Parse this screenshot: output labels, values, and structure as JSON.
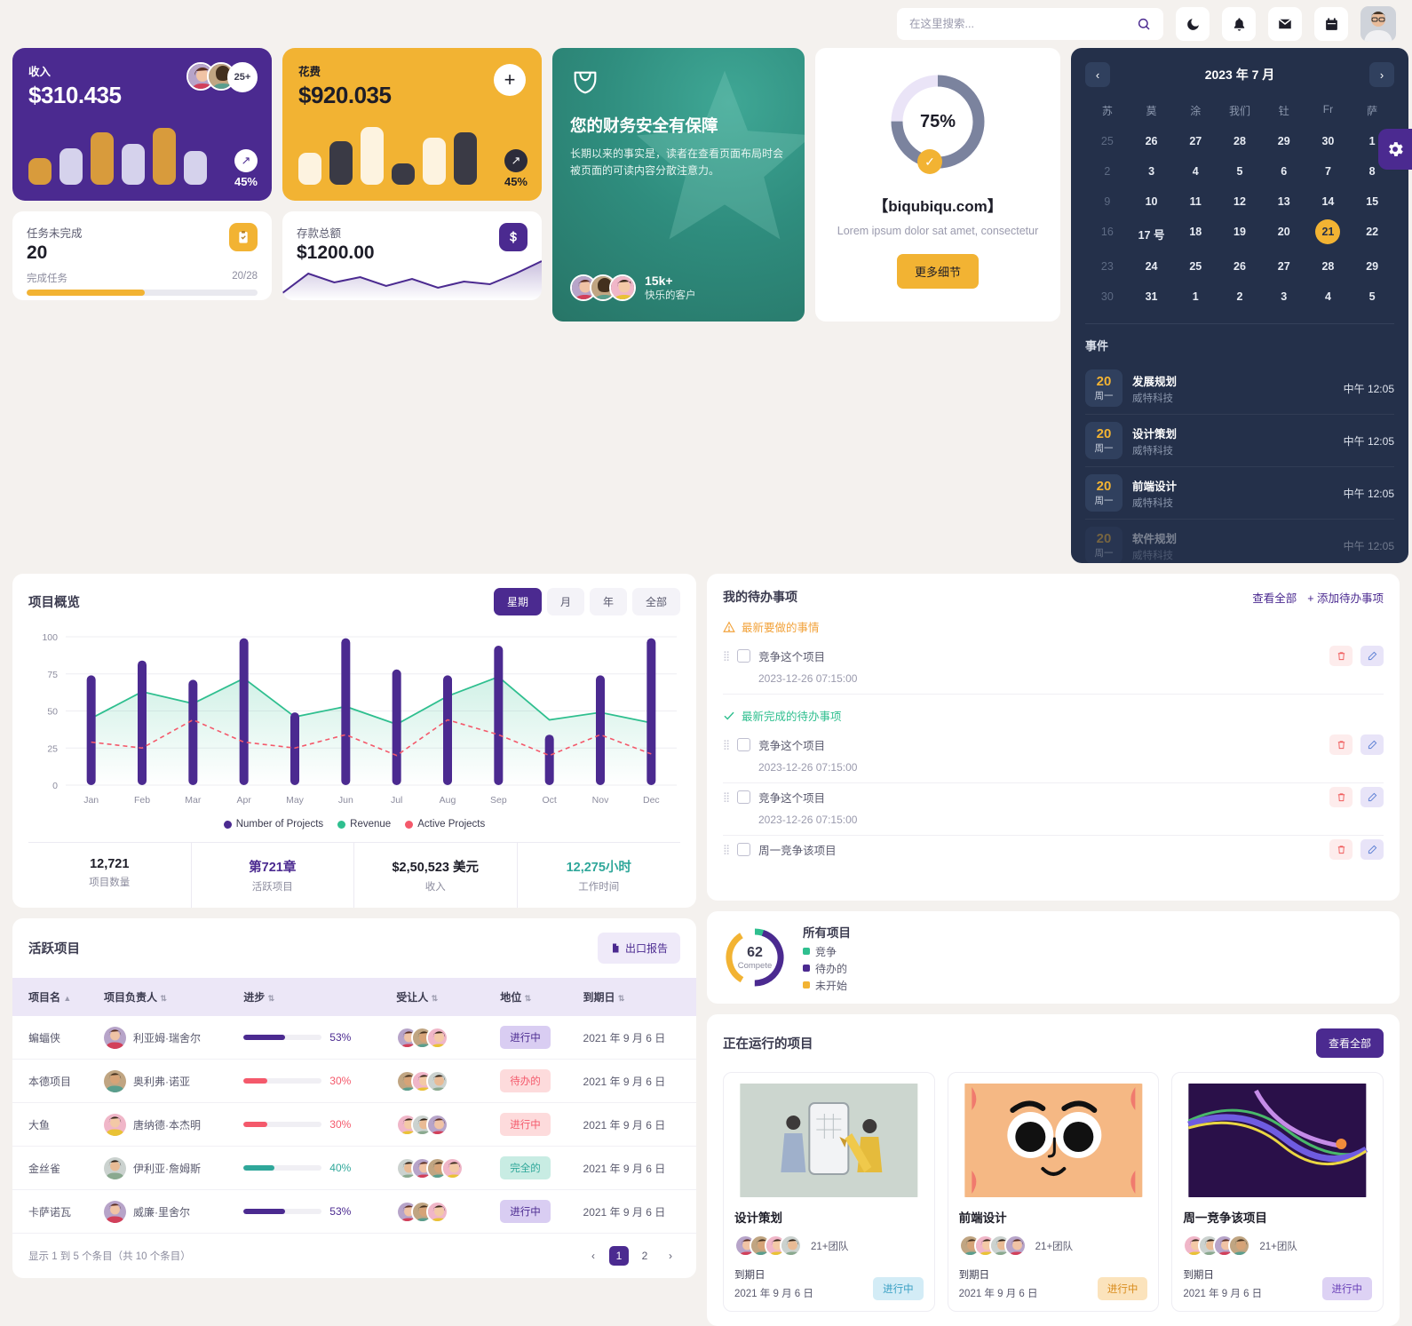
{
  "header": {
    "search_placeholder": "在这里搜索...",
    "search_value": "",
    "icons": [
      "moon-icon",
      "bell-icon",
      "envelope-icon",
      "calendar-icon"
    ]
  },
  "settings_tab": {
    "icon": "gear-icon"
  },
  "revenue_card": {
    "label": "收入",
    "value": "$310.435",
    "avatar_more": "25+",
    "trend_pct": "45%",
    "bars": [
      40,
      55,
      80,
      62,
      86,
      52
    ],
    "bar_colors": [
      "#d89b3c",
      "#d5d2ec",
      "#d89b3c",
      "#d5d2ec",
      "#d89b3c",
      "#d5d2ec"
    ]
  },
  "expense_card": {
    "label": "花费",
    "value": "$920.035",
    "add_label": "+",
    "trend_pct": "45%",
    "bars": [
      48,
      66,
      88,
      33,
      72,
      80
    ],
    "bar_colors": [
      "#fdf3e0",
      "#3a3a45",
      "#fdf3e0",
      "#3a3a45",
      "#fdf3e0",
      "#3a3a45"
    ]
  },
  "tasks_card": {
    "label": "任务未完成",
    "value": "20",
    "sub_label": "完成任务",
    "sub_value": "20/28",
    "progress_pct": 51,
    "progress_color": "#f2b333",
    "icon": "clipboard-icon"
  },
  "deposit_card": {
    "label": "存款总额",
    "value": "$1200.00",
    "icon": "dollar-icon",
    "spark": [
      14,
      40,
      28,
      36,
      22,
      34,
      20,
      30,
      26,
      40,
      58
    ]
  },
  "promo_card": {
    "title": "您的财务安全有保障",
    "body": "长期以来的事实是，读者在查看页面布局时会被页面的可读内容分散注意力。",
    "count": "15k+",
    "caption": "快乐的客户",
    "logo": "shield-logo-icon"
  },
  "progress_card": {
    "percent": "75%",
    "percent_value": 75,
    "brand": "【biqubiqu.com】",
    "description": "Lorem ipsum dolor sat amet, consectetur",
    "button": "更多细节",
    "check_icon": "check-icon"
  },
  "calendar": {
    "title": "2023 年 7 月",
    "prev_icon": "chevron-left-icon",
    "next_icon": "chevron-right-icon",
    "dow": [
      "苏",
      "莫",
      "涂",
      "我们",
      "钍",
      "Fr",
      "萨"
    ],
    "weeks": [
      [
        {
          "d": "25",
          "mut": true
        },
        {
          "d": "26"
        },
        {
          "d": "27"
        },
        {
          "d": "28"
        },
        {
          "d": "29"
        },
        {
          "d": "30"
        },
        {
          "d": "1"
        }
      ],
      [
        {
          "d": "2",
          "mut": true
        },
        {
          "d": "3"
        },
        {
          "d": "4"
        },
        {
          "d": "5"
        },
        {
          "d": "6"
        },
        {
          "d": "7"
        },
        {
          "d": "8"
        }
      ],
      [
        {
          "d": "9",
          "mut": true
        },
        {
          "d": "10"
        },
        {
          "d": "11"
        },
        {
          "d": "12"
        },
        {
          "d": "13"
        },
        {
          "d": "14"
        },
        {
          "d": "15"
        }
      ],
      [
        {
          "d": "16",
          "mut": true
        },
        {
          "d": "17 号"
        },
        {
          "d": "18"
        },
        {
          "d": "19"
        },
        {
          "d": "20"
        },
        {
          "d": "21",
          "sel": true
        },
        {
          "d": "22"
        }
      ],
      [
        {
          "d": "23",
          "mut": true
        },
        {
          "d": "24"
        },
        {
          "d": "25"
        },
        {
          "d": "26"
        },
        {
          "d": "27"
        },
        {
          "d": "28"
        },
        {
          "d": "29"
        }
      ],
      [
        {
          "d": "30",
          "mut": true
        },
        {
          "d": "31"
        },
        {
          "d": "1"
        },
        {
          "d": "2"
        },
        {
          "d": "3"
        },
        {
          "d": "4"
        },
        {
          "d": "5"
        }
      ]
    ],
    "events_title": "事件",
    "events": [
      {
        "day": "20",
        "weekday": "周一",
        "name": "发展规划",
        "company": "威特科技",
        "time": "中午 12:05"
      },
      {
        "day": "20",
        "weekday": "周一",
        "name": "设计策划",
        "company": "威特科技",
        "time": "中午 12:05"
      },
      {
        "day": "20",
        "weekday": "周一",
        "name": "前端设计",
        "company": "威特科技",
        "time": "中午 12:05"
      },
      {
        "day": "20",
        "weekday": "周一",
        "name": "软件规划",
        "company": "威特科技",
        "time": "中午 12:05"
      }
    ]
  },
  "all_projects": {
    "center_value": "62",
    "center_label": "Compete",
    "title": "所有项目",
    "legend": [
      {
        "label": "竞争",
        "color": "#2fbf8f"
      },
      {
        "label": "待办的",
        "color": "#4b2a90"
      },
      {
        "label": "未开始",
        "color": "#f2b333"
      }
    ]
  },
  "chart_card": {
    "title": "项目概览",
    "tabs": [
      {
        "label": "星期",
        "active": true
      },
      {
        "label": "月",
        "active": false
      },
      {
        "label": "年",
        "active": false
      },
      {
        "label": "全部",
        "active": false
      }
    ],
    "kpis": [
      {
        "value": "12,721",
        "caption": "项目数量",
        "color": "#1d1d28"
      },
      {
        "value": "第721章",
        "caption": "活跃项目",
        "color": "#4b2a90"
      },
      {
        "value": "$2,50,523 美元",
        "caption": "收入",
        "color": "#1d1d28"
      },
      {
        "value": "12,275小时",
        "caption": "工作时间",
        "color": "#2fa79a"
      }
    ]
  },
  "chart_data": {
    "type": "bar",
    "title": "项目概览",
    "xlabel": "",
    "ylabel": "",
    "ylim": [
      0,
      100
    ],
    "yticks": [
      0,
      25,
      50,
      75,
      100
    ],
    "grid": true,
    "legend_position": "bottom",
    "categories": [
      "Jan",
      "Feb",
      "Mar",
      "Apr",
      "May",
      "Jun",
      "Jul",
      "Aug",
      "Sep",
      "Oct",
      "Nov",
      "Dec"
    ],
    "series": [
      {
        "name": "Number of Projects",
        "type": "bar",
        "color": "#4b2a90",
        "values": [
          74,
          84,
          71,
          99,
          49,
          99,
          78,
          74,
          94,
          34,
          74,
          99
        ]
      },
      {
        "name": "Revenue",
        "type": "area",
        "color": "#2fbf8f",
        "values": [
          45,
          63,
          55,
          72,
          46,
          53,
          41,
          60,
          73,
          44,
          49,
          42
        ]
      },
      {
        "name": "Active Projects",
        "type": "line",
        "color": "#f4596b",
        "dashed": true,
        "values": [
          29,
          25,
          44,
          29,
          25,
          34,
          20,
          44,
          34,
          20,
          34,
          21
        ]
      }
    ]
  },
  "todo": {
    "title": "我的待办事项",
    "view_all": "查看全部",
    "add": "+ 添加待办事项",
    "group_pending": "最新要做的事情",
    "group_done": "最新完成的待办事项",
    "items": [
      {
        "text": "竞争这个项目",
        "date": "2023-12-26 07:15:00"
      },
      {
        "text": "竞争这个项目",
        "date": "2023-12-26 07:15:00"
      },
      {
        "text": "竞争这个项目",
        "date": "2023-12-26 07:15:00"
      },
      {
        "text": "周一竞争该项目",
        "date": ""
      }
    ],
    "delete_icon": "trash-icon",
    "edit_icon": "pencil-icon"
  },
  "table": {
    "title": "活跃项目",
    "export_label": "出口报告",
    "export_icon": "file-export-icon",
    "columns": [
      "项目名",
      "项目负责人",
      "进步",
      "受让人",
      "地位",
      "到期日"
    ],
    "rows": [
      {
        "name": "蝙蝠侠",
        "owner": "利亚姆·瑞舍尔",
        "progress": 53,
        "progress_color": "#4b2a90",
        "pct_color": "#4b2a90",
        "assignees": 3,
        "status": "进行中",
        "status_bg": "#d9cdf2",
        "status_fg": "#4b2a90",
        "due": "2021 年 9 月 6 日"
      },
      {
        "name": "本德项目",
        "owner": "奥利弗·诺亚",
        "progress": 30,
        "progress_color": "#f4596b",
        "pct_color": "#f4596b",
        "assignees": 3,
        "status": "待办的",
        "status_bg": "#fddbdc",
        "status_fg": "#f4596b",
        "due": "2021 年 9 月 6 日"
      },
      {
        "name": "大鱼",
        "owner": "唐纳德·本杰明",
        "progress": 30,
        "progress_color": "#f4596b",
        "pct_color": "#f4596b",
        "assignees": 3,
        "status": "进行中",
        "status_bg": "#fddbdc",
        "status_fg": "#f4596b",
        "due": "2021 年 9 月 6 日"
      },
      {
        "name": "金丝雀",
        "owner": "伊利亚·詹姆斯",
        "progress": 40,
        "progress_color": "#2fa79a",
        "pct_color": "#2fa79a",
        "assignees": 4,
        "status": "完全的",
        "status_bg": "#c8ece3",
        "status_fg": "#2fa79a",
        "due": "2021 年 9 月 6 日"
      },
      {
        "name": "卡萨诺瓦",
        "owner": "威廉·里舍尔",
        "progress": 53,
        "progress_color": "#4b2a90",
        "pct_color": "#4b2a90",
        "assignees": 3,
        "status": "进行中",
        "status_bg": "#d9cdf2",
        "status_fg": "#4b2a90",
        "due": "2021 年 9 月 6 日"
      }
    ],
    "footer": "显示 1 到 5 个条目（共 10 个条目）",
    "pages": [
      "1",
      "2"
    ],
    "active_page": "1",
    "prev_icon": "chevron-left-icon",
    "next_icon": "chevron-right-icon"
  },
  "running": {
    "title": "正在运行的项目",
    "view_all": "查看全部",
    "cards": [
      {
        "name": "设计策划",
        "team": "21+团队",
        "due_label": "到期日",
        "due": "2021 年 9 月 6 日",
        "status": "进行中",
        "status_bg": "#d3ecf6",
        "status_fg": "#3aa0c4",
        "thumb": "design-illustration"
      },
      {
        "name": "前端设计",
        "team": "21+团队",
        "due_label": "到期日",
        "due": "2021 年 9 月 6 日",
        "status": "进行中",
        "status_bg": "#fbe3bc",
        "status_fg": "#d98c1d",
        "thumb": "character-illustration"
      },
      {
        "name": "周一竞争该项目",
        "team": "21+团队",
        "due_label": "到期日",
        "due": "2021 年 9 月 6 日",
        "status": "进行中",
        "status_bg": "#ddd2f4",
        "status_fg": "#6b43b8",
        "thumb": "wave-illustration"
      }
    ]
  }
}
